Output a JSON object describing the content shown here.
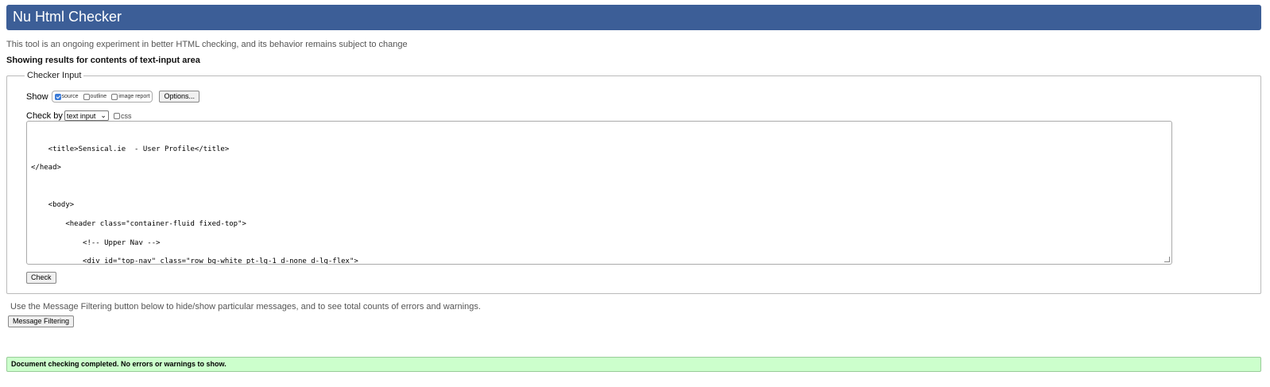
{
  "header": {
    "title": "Nu Html Checker"
  },
  "intro_text": "This tool is an ongoing experiment in better HTML checking, and its behavior remains subject to change",
  "results_for": "Showing results for contents of text-input area",
  "checker_input": {
    "legend": "Checker Input",
    "show_label": "Show",
    "show_options": [
      {
        "label": "source",
        "checked": true
      },
      {
        "label": "outline",
        "checked": false
      },
      {
        "label": "image report",
        "checked": false
      }
    ],
    "options_button": "Options...",
    "check_by_label": "Check by",
    "check_by_value": "text input",
    "css_label": "css",
    "source_lines": [
      "",
      "    <title>Sensical.ie  - User Profile</title>",
      "</head>",
      "",
      "    <body>",
      "        <header class=\"container-fluid fixed-top\">",
      "            <!-- Upper Nav -->",
      "            <div id=\"top-nav\" class=\"row bg-white pt-lg-1 d-none d-lg-flex\">"
    ],
    "check_button": "Check"
  },
  "filter_note": "Use the Message Filtering button below to hide/show particular messages, and to see total counts of errors and warnings.",
  "filter_button": "Message Filtering",
  "status_message": "Document checking completed. No errors or warnings to show.",
  "colors": {
    "header_bg": "#3c5e97",
    "success_bg": "#ccffcc"
  }
}
